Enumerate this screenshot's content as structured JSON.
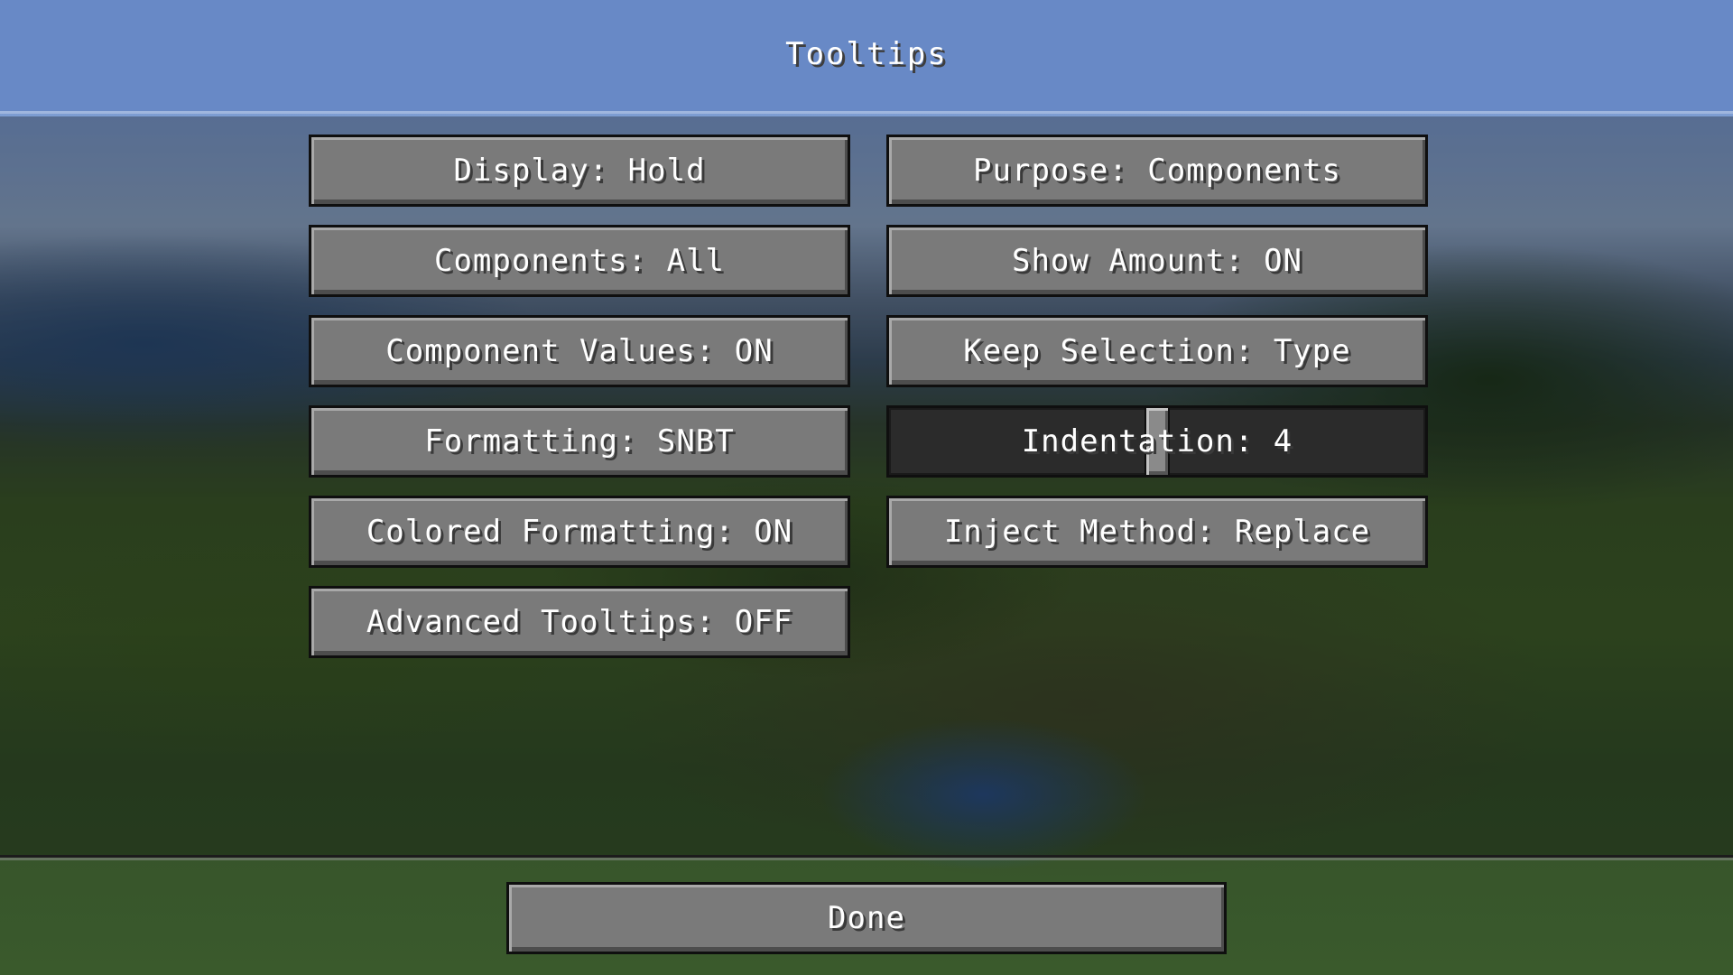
{
  "screen": {
    "title": "Tooltips"
  },
  "options": {
    "left": [
      {
        "label": "Display: Hold"
      },
      {
        "label": "Components: All"
      },
      {
        "label": "Component Values: ON"
      },
      {
        "label": "Formatting: SNBT"
      },
      {
        "label": "Colored Formatting: ON"
      },
      {
        "label": "Advanced Tooltips: OFF"
      }
    ],
    "right": [
      {
        "label": "Purpose: Components"
      },
      {
        "label": "Show Amount: ON"
      },
      {
        "label": "Keep Selection: Type"
      },
      {
        "label": "Indentation: 4",
        "slider_value": 0.5
      },
      {
        "label": "Inject Method: Replace"
      }
    ]
  },
  "footer": {
    "done_label": "Done"
  }
}
